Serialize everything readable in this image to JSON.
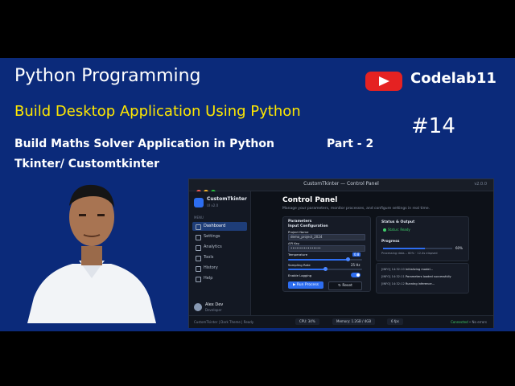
{
  "thumbnail": {
    "title": "Python Programming",
    "subtitle": "Build Desktop Application Using Python",
    "line1": "Build Maths Solver Application in Python",
    "part": "Part - 2",
    "line2": "Tkinter/ Customtkinter",
    "brand": "Codelab11",
    "episode": "#14",
    "colors": {
      "background": "#0b2a7a",
      "subtitle": "#ffe800",
      "youtube_red": "#e52222"
    },
    "icons": [
      "youtube-play-icon"
    ]
  },
  "app": {
    "window_title": "CustomTkinter — Control Panel",
    "version_corner": "v2.0.0",
    "sidebar": {
      "app_name": "CustomTkinter",
      "app_version": "UI v2.0",
      "menu_header": "MENU",
      "items": [
        {
          "label": "Dashboard",
          "icon": "home-icon",
          "active": true
        },
        {
          "label": "Settings",
          "icon": "gear-icon",
          "active": false
        },
        {
          "label": "Analytics",
          "icon": "chart-icon",
          "active": false
        },
        {
          "label": "Tools",
          "icon": "wrench-icon",
          "active": false
        },
        {
          "label": "History",
          "icon": "clock-icon",
          "active": false
        },
        {
          "label": "Help",
          "icon": "help-icon",
          "active": false
        }
      ],
      "user_name": "Alex Dev",
      "user_role": "Developer"
    },
    "main": {
      "heading": "Control Panel",
      "subheading": "Manage your parameters, monitor processes, and configure settings in real time.",
      "params": {
        "title": "Parameters",
        "section": "Input Configuration",
        "project_label": "Project Name",
        "project_value": "demo_project_2024",
        "api_label": "API Key",
        "api_value": "••••••••••••••••",
        "temp_label": "Temperature",
        "temp_value": "0.8",
        "temp_level": 0.8,
        "rate_label": "Sampling Rate",
        "rate_value": "25 Hz",
        "rate_level": 0.5,
        "logging_label": "Enable Logging",
        "logging_on": true,
        "run_label": "Run Process",
        "reset_label": "Reset"
      },
      "status": {
        "title": "Status & Output",
        "state": "Status: Ready",
        "progress_label": "Progress",
        "progress_pct": "60%",
        "progress_value": 0.6,
        "progress_detail": "Processing data... 60% · 12.4s elapsed"
      },
      "log": [
        {
          "time": "[INFO] 14:32:10",
          "msg": "Initializing model..."
        },
        {
          "time": "[INFO] 14:32:11",
          "msg": "Parameters loaded successfully"
        },
        {
          "time": "[INFO] 14:32:12",
          "msg": "Running inference..."
        }
      ]
    },
    "statusbar": {
      "left": "CustomTkinter | Dark Theme | Ready",
      "cpu": "CPU: 34%",
      "memory": "Memory: 1.2GB / 4GB",
      "fps": "6 fps",
      "right_label": "Connected",
      "right_ok": "• No errors"
    },
    "colors": {
      "accent": "#2d6df0",
      "ok": "#3fcf6a",
      "window": "#0d1118"
    }
  }
}
